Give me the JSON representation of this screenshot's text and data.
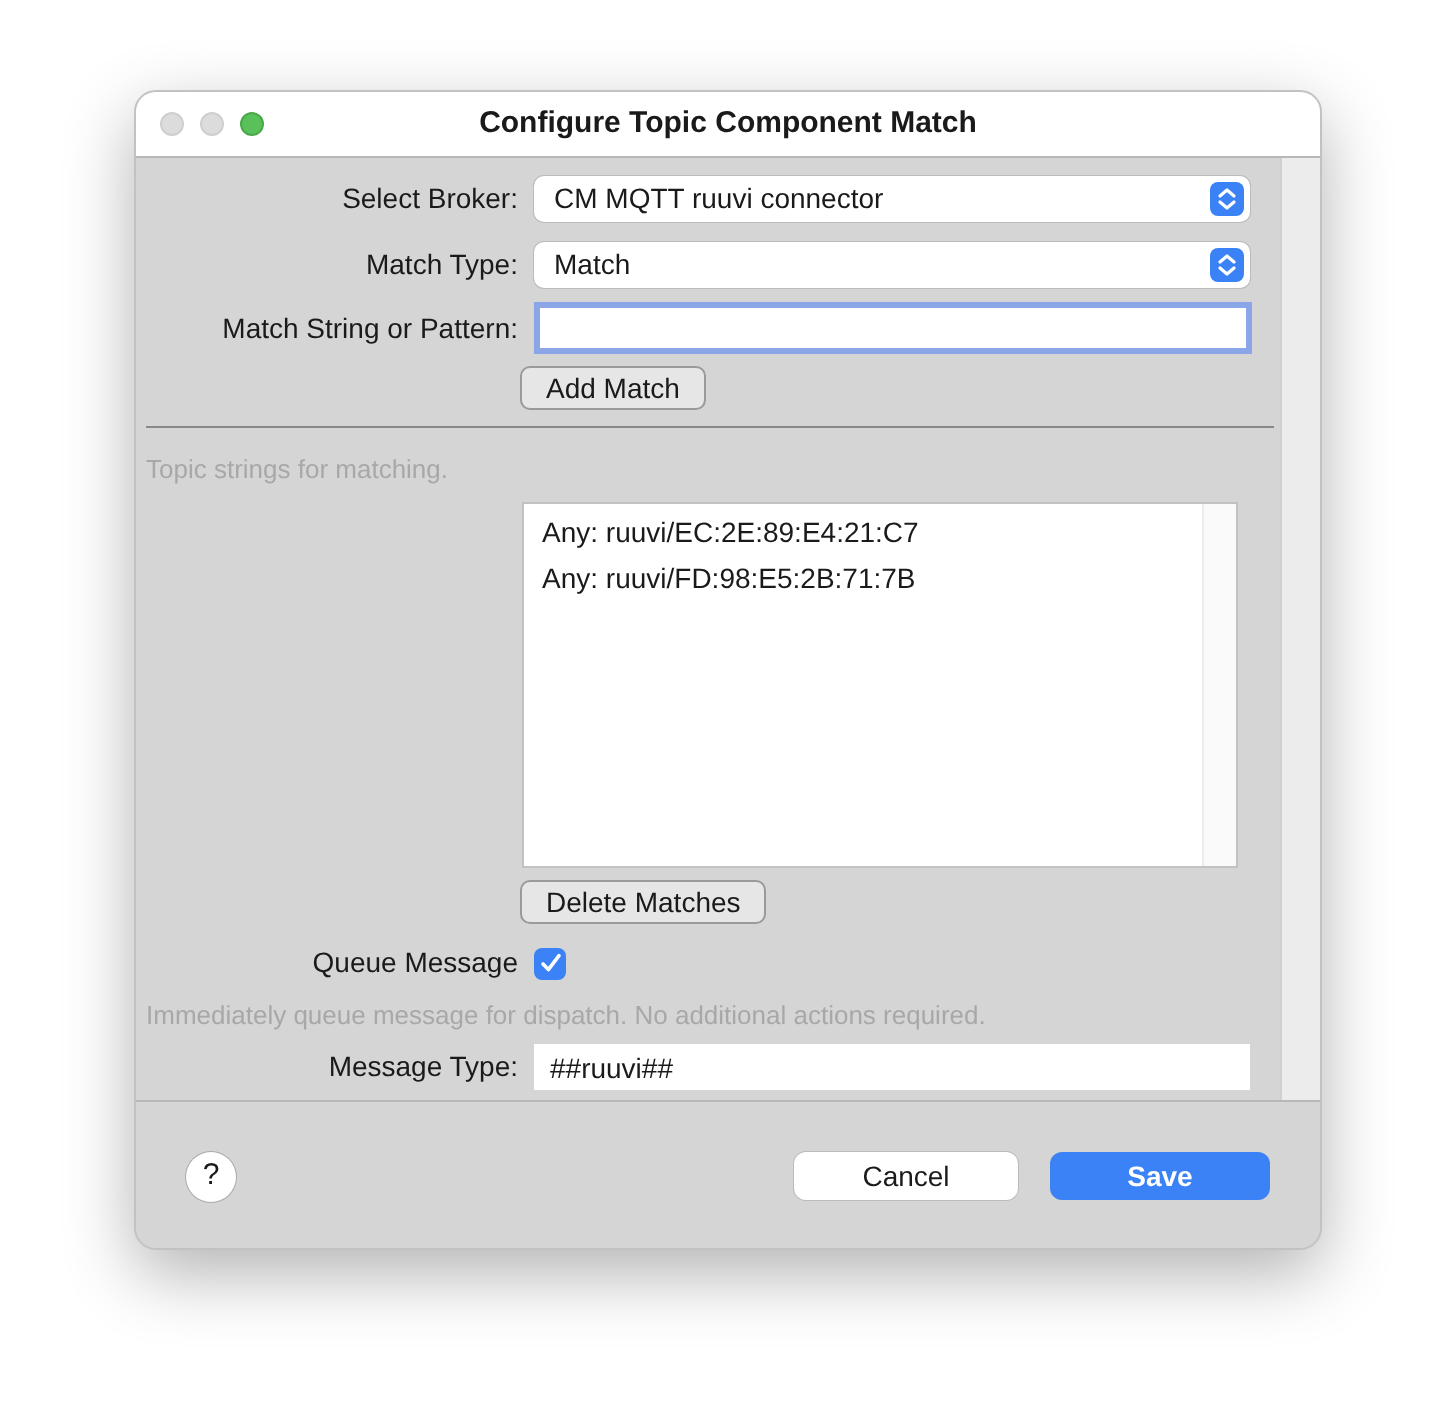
{
  "window": {
    "title": "Configure Topic Component Match"
  },
  "broker": {
    "label": "Select Broker:",
    "value": "CM MQTT ruuvi connector"
  },
  "match_type": {
    "label": "Match Type:",
    "value": "Match"
  },
  "match_string": {
    "label": "Match String or Pattern:",
    "focused": true
  },
  "add_button": "Add Match",
  "list_hint": "Topic strings for matching.",
  "matches": [
    {
      "text": "Any: ruuvi/EC:2E:89:E4:21:C7",
      "selected": false
    },
    {
      "text": "Any: ruuvi/FD:98:E5:2B:71:7B",
      "selected": false
    }
  ],
  "delete_button": "Delete Matches",
  "queue": {
    "label": "Queue Message",
    "checked": true,
    "hint": "Immediately queue message for dispatch.  No additional actions required."
  },
  "message_type": {
    "label": "Message Type:",
    "value": "##ruuvi##"
  },
  "help_button": "?",
  "cancel_button": "Cancel",
  "save_button": "Save"
}
